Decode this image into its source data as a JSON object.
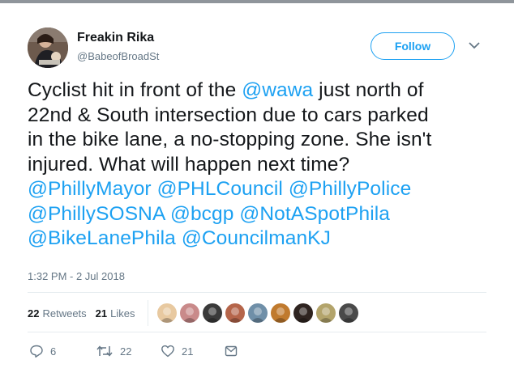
{
  "user": {
    "name": "Freakin Rika",
    "handle": "@BabeofBroadSt",
    "follow_label": "Follow"
  },
  "tweet": {
    "lines": [
      [
        {
          "t": "Cyclist hit in front of the "
        },
        {
          "t": "@wawa",
          "m": true
        },
        {
          "t": " just north of"
        }
      ],
      [
        {
          "t": "22nd & South intersection due to cars parked"
        }
      ],
      [
        {
          "t": "in the bike lane, a no-stopping zone. She isn't"
        }
      ],
      [
        {
          "t": "injured. What will happen next time?"
        }
      ],
      [
        {
          "t": "@PhillyMayor",
          "m": true
        },
        {
          "t": " "
        },
        {
          "t": "@PHLCouncil",
          "m": true
        },
        {
          "t": " "
        },
        {
          "t": "@PhillyPolice",
          "m": true
        }
      ],
      [
        {
          "t": "@PhillySOSNA",
          "m": true
        },
        {
          "t": " "
        },
        {
          "t": "@bcgp",
          "m": true
        },
        {
          "t": " "
        },
        {
          "t": "@NotASpotPhila",
          "m": true
        }
      ],
      [
        {
          "t": "@BikeLanePhila",
          "m": true
        },
        {
          "t": " "
        },
        {
          "t": "@CouncilmanKJ",
          "m": true
        }
      ]
    ]
  },
  "timestamp": "1:32 PM - 2 Jul 2018",
  "stats": {
    "retweets_count": "22",
    "retweets_label": "Retweets",
    "likes_count": "21",
    "likes_label": "Likes"
  },
  "likers": [
    {
      "icon": "avatar-bearded-man",
      "bg": "#e8c9a0"
    },
    {
      "icon": "avatar-couple",
      "bg": "#c98a8a"
    },
    {
      "icon": "avatar-bw-portrait",
      "bg": "#3a3a3a"
    },
    {
      "icon": "avatar-city-skyline",
      "bg": "#b5654a"
    },
    {
      "icon": "avatar-landscape",
      "bg": "#6f8fa8"
    },
    {
      "icon": "avatar-colorful",
      "bg": "#c07a2e"
    },
    {
      "icon": "avatar-dark-portrait",
      "bg": "#2f2420"
    },
    {
      "icon": "avatar-outdoor",
      "bg": "#b3a46b"
    },
    {
      "icon": "avatar-sunglasses",
      "bg": "#4a4a4a"
    }
  ],
  "actions": {
    "replies": "6",
    "retweets": "22",
    "likes": "21"
  },
  "colors": {
    "accent": "#1da1f2",
    "muted": "#657786",
    "text": "#14171a",
    "divider": "#e6ecf0"
  }
}
